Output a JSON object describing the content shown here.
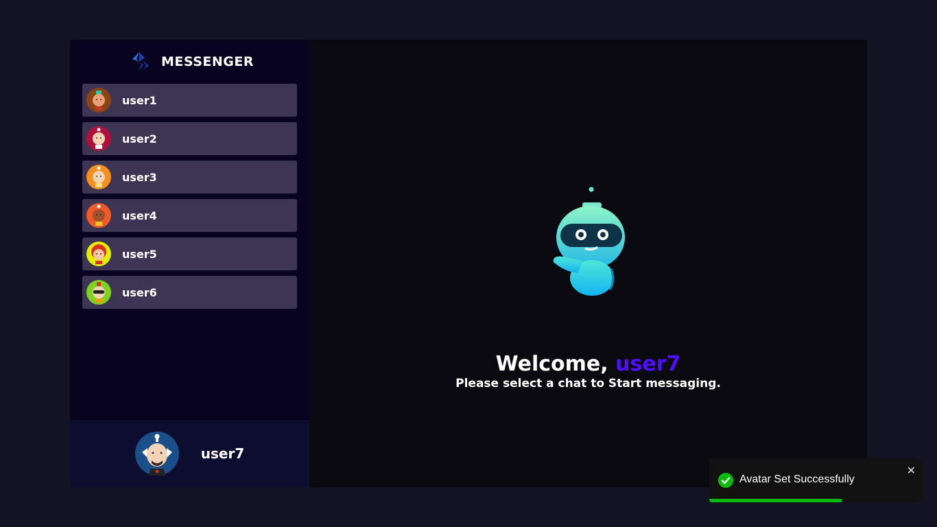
{
  "brand": {
    "name": "MESSENGER",
    "logo_icon": "messenger-logo-icon"
  },
  "contacts": [
    {
      "name": "user1",
      "avatar_color": "#8b4513"
    },
    {
      "name": "user2",
      "avatar_color": "#b0103a"
    },
    {
      "name": "user3",
      "avatar_color": "#f5901e"
    },
    {
      "name": "user4",
      "avatar_color": "#f05a28"
    },
    {
      "name": "user5",
      "avatar_color": "#e2f000"
    },
    {
      "name": "user6",
      "avatar_color": "#7ed321"
    }
  ],
  "current_user": {
    "name": "user7",
    "avatar_color": "#1b4f8c"
  },
  "welcome": {
    "greeting": "Welcome,",
    "username": "user7",
    "subtitle": "Please select a chat to Start messaging."
  },
  "toast": {
    "message": "Avatar Set Successfully",
    "close_label": "✕",
    "progress": 0.62,
    "color": "#07bc0c"
  },
  "colors": {
    "background": "#131324",
    "sidebar": "#080420",
    "contact": "#3d3551",
    "accent": "#4e0eff"
  }
}
